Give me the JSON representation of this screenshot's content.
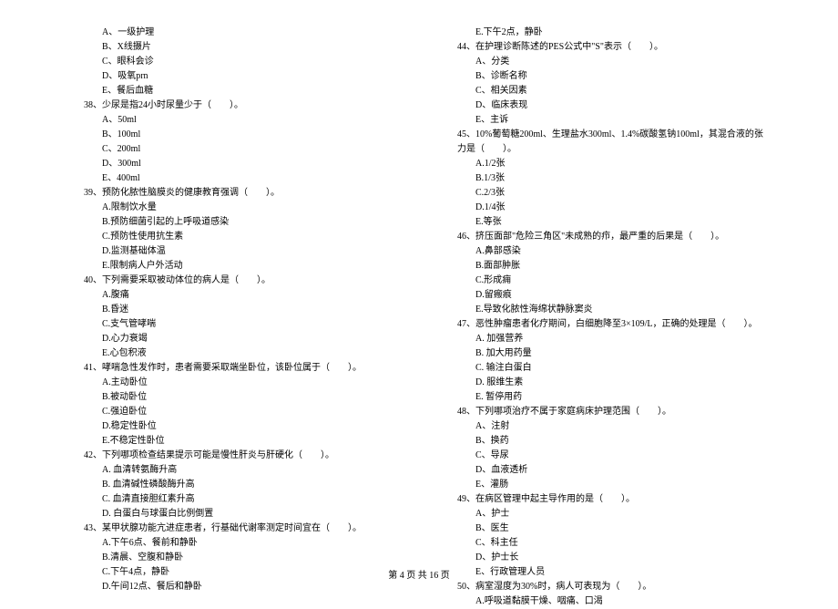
{
  "left_column": {
    "q37_options": [
      "A、一级护理",
      "B、X线摄片",
      "C、眼科会诊",
      "D、吸氧prn",
      "E、餐后血糖"
    ],
    "q38": "38、少尿是指24小时尿量少于（　　）。",
    "q38_options": [
      "A、50ml",
      "B、100ml",
      "C、200ml",
      "D、300ml",
      "E、400ml"
    ],
    "q39": "39、预防化脓性脑膜炎的健康教育强调（　　）。",
    "q39_options": [
      "A.限制饮水量",
      "B.预防细菌引起的上呼吸道感染",
      "C.预防性使用抗生素",
      "D.监测基础体温",
      "E.限制病人户外活动"
    ],
    "q40": "40、下列需要采取被动体位的病人是（　　）。",
    "q40_options": [
      "A.腹痛",
      "B.昏迷",
      "C.支气管哮喘",
      "D.心力衰竭",
      "E.心包积液"
    ],
    "q41": "41、哮喘急性发作时，患者需要采取端坐卧位，该卧位属于（　　）。",
    "q41_options": [
      "A.主动卧位",
      "B.被动卧位",
      "C.强迫卧位",
      "D.稳定性卧位",
      "E.不稳定性卧位"
    ],
    "q42": "42、下列哪项检查结果提示可能是慢性肝炎与肝硬化（　　）。",
    "q42_options": [
      "A. 血清转氨酶升高",
      "B. 血清碱性磷酸酶升高",
      "C. 血清直接胆红素升高",
      "D. 白蛋白与球蛋白比例倒置"
    ],
    "q43": "43、某甲状腺功能亢进症患者，行基础代谢率测定时间宜在（　　）。",
    "q43_options": [
      "A.下午6点、餐前和静卧",
      "B.清晨、空腹和静卧",
      "C.下午4点，静卧",
      "D.午间12点、餐后和静卧"
    ]
  },
  "right_column": {
    "q43_cont": [
      "E.下午2点，静卧"
    ],
    "q44": "44、在护理诊断陈述的PES公式中\"S\"表示（　　）。",
    "q44_options": [
      "A、分类",
      "B、诊断名称",
      "C、相关因素",
      "D、临床表现",
      "E、主诉"
    ],
    "q45": "45、10%葡萄糖200ml、生理盐水300ml、1.4%碳酸氢钠100ml，其混合液的张力是（　　）。",
    "q45_options": [
      "A.1/2张",
      "B.1/3张",
      "C.2/3张",
      "D.1/4张",
      "E.等张"
    ],
    "q46": "46、挤压面部\"危险三角区\"未成熟的疖，最严重的后果是（　　）。",
    "q46_options": [
      "A.鼻部感染",
      "B.面部肿胀",
      "C.形成痈",
      "D.留瘢痕",
      "E.导致化脓性海绵状静脉窦炎"
    ],
    "q47": "47、恶性肿瘤患者化疗期间，白细胞降至3×109/L，正确的处理是（　　）。",
    "q47_options": [
      "A. 加强营养",
      "B. 加大用药量",
      "C. 输注白蛋白",
      "D. 服维生素",
      "E. 暂停用药"
    ],
    "q48": "48、下列哪项治疗不属于家庭病床护理范围（　　）。",
    "q48_options": [
      "A、注射",
      "B、换药",
      "C、导尿",
      "D、血液透析",
      "E、灌肠"
    ],
    "q49": "49、在病区管理中起主导作用的是（　　）。",
    "q49_options": [
      "A、护士",
      "B、医生",
      "C、科主任",
      "D、护士长",
      "E、行政管理人员"
    ],
    "q50": "50、病室湿度为30%时，病人可表现为（　　）。",
    "q50_options": [
      "A.呼吸道黏膜干燥、咽痛、口渴"
    ]
  },
  "footer": "第 4 页 共 16 页"
}
